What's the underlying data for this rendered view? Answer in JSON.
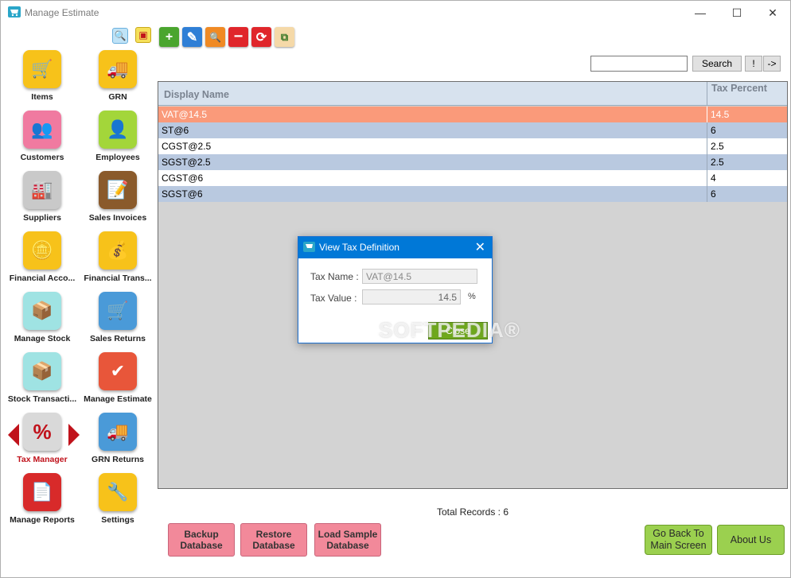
{
  "window": {
    "title": "Manage Estimate",
    "minimize": "—",
    "maximize": "☐",
    "close": "✕"
  },
  "sidebar": {
    "top_icons": [
      {
        "name": "search-icon",
        "glyph": "🔍"
      },
      {
        "name": "windows-icon",
        "glyph": "▣"
      }
    ],
    "items": [
      {
        "label": "Items",
        "icon": "shopping-cart-icon",
        "glyph": "🛒",
        "color": "#f7c21a"
      },
      {
        "label": "GRN",
        "icon": "truck-icon",
        "glyph": "🚚",
        "color": "#f7c21a"
      },
      {
        "label": "Customers",
        "icon": "users-icon",
        "glyph": "👥",
        "color": "#f07aa0"
      },
      {
        "label": "Employees",
        "icon": "employee-icon",
        "glyph": "👤",
        "color": "#a3d63a"
      },
      {
        "label": "Suppliers",
        "icon": "factory-icon",
        "glyph": "🏭",
        "color": "#c9c9c9"
      },
      {
        "label": "Sales Invoices",
        "icon": "invoice-icon",
        "glyph": "📝",
        "color": "#8a5a2b"
      },
      {
        "label": "Financial Acco...",
        "icon": "coins-icon",
        "glyph": "🪙",
        "color": "#f7c21a"
      },
      {
        "label": "Financial Trans...",
        "icon": "coins-transfer-icon",
        "glyph": "💰",
        "color": "#f7c21a"
      },
      {
        "label": "Manage Stock",
        "icon": "stock-cart-icon",
        "glyph": "📦",
        "color": "#9fe3e3"
      },
      {
        "label": "Sales Returns",
        "icon": "return-cart-icon",
        "glyph": "🛒",
        "color": "#4a9ad8"
      },
      {
        "label": "Stock Transacti...",
        "icon": "stock-transfer-icon",
        "glyph": "📦",
        "color": "#9fe3e3"
      },
      {
        "label": "Manage Estimate",
        "icon": "estimate-check-icon",
        "glyph": "✔",
        "color": "#e8563a"
      },
      {
        "label": "Tax Manager",
        "icon": "percent-icon",
        "glyph": "%",
        "color": "#d9d9d9"
      },
      {
        "label": "GRN Returns",
        "icon": "return-truck-icon",
        "glyph": "🚚",
        "color": "#4a9ad8"
      },
      {
        "label": "Manage Reports",
        "icon": "report-icon",
        "glyph": "📄",
        "color": "#d82a2a"
      },
      {
        "label": "Settings",
        "icon": "tools-icon",
        "glyph": "🔧",
        "color": "#f7c21a"
      }
    ]
  },
  "toolbar": [
    {
      "name": "add-button",
      "icon": "plus-icon",
      "glyph": "+",
      "color": "#4aa52e"
    },
    {
      "name": "edit-button",
      "icon": "pencil-icon",
      "glyph": "✎",
      "color": "#2f7fd6"
    },
    {
      "name": "view-button",
      "icon": "magnify-icon",
      "glyph": "🔍",
      "color": "#f08a24"
    },
    {
      "name": "delete-button",
      "icon": "minus-icon",
      "glyph": "−",
      "color": "#e0262b"
    },
    {
      "name": "refresh-button",
      "icon": "refresh-icon",
      "glyph": "⟳",
      "color": "#e0262b"
    },
    {
      "name": "hierarchy-button",
      "icon": "hierarchy-icon",
      "glyph": "⧉",
      "color": "#f5d9a8"
    }
  ],
  "search": {
    "value": "",
    "button": "Search",
    "exclaim": "!",
    "next": "->"
  },
  "table": {
    "columns": [
      "Display Name",
      "Tax Percent"
    ],
    "rows": [
      {
        "name": "VAT@14.5",
        "percent": "14.5"
      },
      {
        "name": "ST@6",
        "percent": "6"
      },
      {
        "name": "CGST@2.5",
        "percent": "2.5"
      },
      {
        "name": "SGST@2.5",
        "percent": "2.5"
      },
      {
        "name": "CGST@6",
        "percent": "4"
      },
      {
        "name": "SGST@6",
        "percent": "6"
      }
    ]
  },
  "footer": {
    "total_records": "Total Records : 6",
    "backup": "Backup Database",
    "restore": "Restore Database",
    "load_sample": "Load Sample Database",
    "go_back": "Go Back To Main Screen",
    "about": "About Us"
  },
  "dialog": {
    "title": "View Tax Definition",
    "tax_name_label": "Tax Name :",
    "tax_name_value": "VAT@14.5",
    "tax_value_label": "Tax Value :",
    "tax_value_value": "14.5",
    "percent_sign": "%",
    "close": "Close"
  },
  "watermark": "SOFTPEDIA®"
}
